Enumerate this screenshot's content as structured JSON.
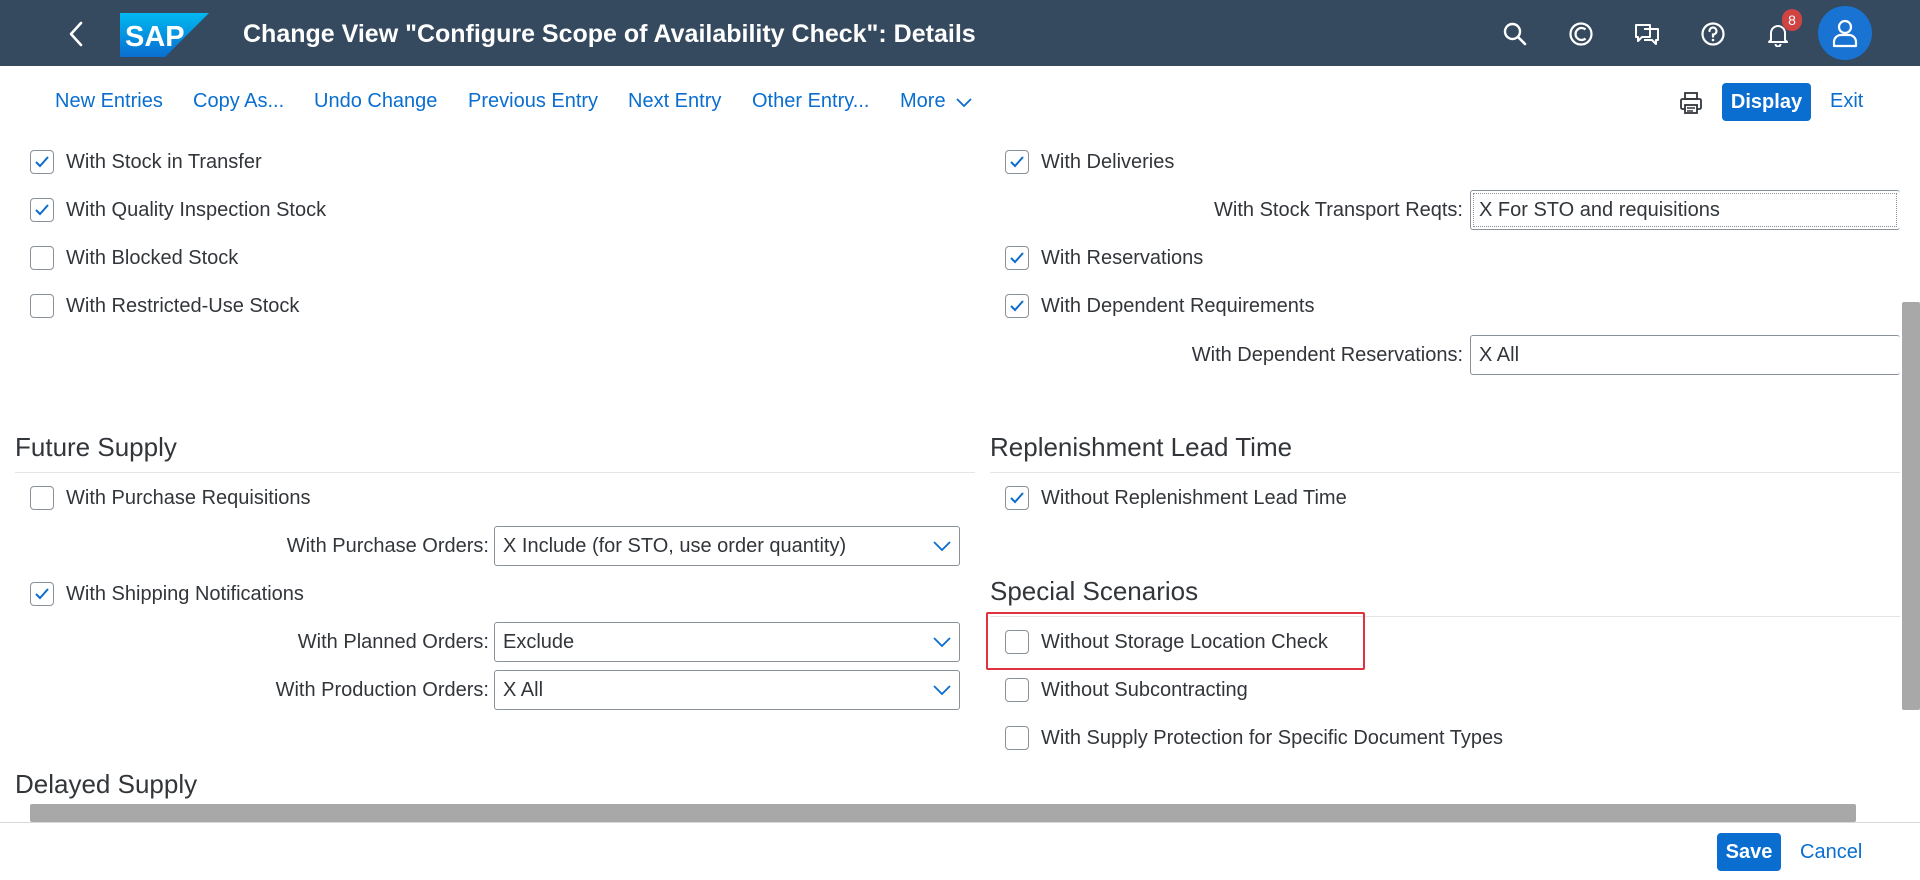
{
  "shell": {
    "logo_text": "SAP",
    "title": "Change View \"Configure Scope of Availability Check\": Details",
    "notification_count": "8",
    "icons": [
      "back-icon",
      "search-icon",
      "copilot-icon",
      "feedback-icon",
      "help-icon",
      "bell-icon",
      "user-icon"
    ],
    "colors": {
      "shell_bg": "#354a5f",
      "accent": "#0a6ed1",
      "badge": "#d04343",
      "highlight": "#e0313f"
    }
  },
  "toolbar": {
    "new_entries": "New Entries",
    "copy_as": "Copy As...",
    "undo_change": "Undo Change",
    "previous_entry": "Previous Entry",
    "next_entry": "Next Entry",
    "other_entry": "Other Entry...",
    "more": "More",
    "display": "Display",
    "exit": "Exit"
  },
  "stock": {
    "with_stock_in_transfer": {
      "label": "With Stock in Transfer",
      "checked": true
    },
    "with_quality_inspection": {
      "label": "With Quality Inspection Stock",
      "checked": true
    },
    "with_blocked_stock": {
      "label": "With Blocked Stock",
      "checked": false
    },
    "with_restricted_use": {
      "label": "With Restricted-Use Stock",
      "checked": false
    }
  },
  "demand": {
    "with_deliveries": {
      "label": "With Deliveries",
      "checked": true
    },
    "stock_transport_reqts_label": "With Stock Transport Reqts:",
    "stock_transport_reqts_value": "X For STO and requisitions",
    "with_reservations": {
      "label": "With Reservations",
      "checked": true
    },
    "with_dependent_requirements": {
      "label": "With Dependent Requirements",
      "checked": true
    },
    "dependent_reservations_label": "With Dependent Reservations:",
    "dependent_reservations_value": "X All"
  },
  "future_supply": {
    "title": "Future Supply",
    "with_purchase_requisitions": {
      "label": "With Purchase Requisitions",
      "checked": false
    },
    "purchase_orders_label": "With Purchase Orders:",
    "purchase_orders_value": "X Include (for STO, use order quantity)",
    "with_shipping_notifications": {
      "label": "With Shipping Notifications",
      "checked": true
    },
    "planned_orders_label": "With Planned Orders:",
    "planned_orders_value": "Exclude",
    "production_orders_label": "With Production Orders:",
    "production_orders_value": "X All"
  },
  "replenishment": {
    "title": "Replenishment Lead Time",
    "without_replenishment": {
      "label": "Without Replenishment Lead Time",
      "checked": true
    }
  },
  "special": {
    "title": "Special Scenarios",
    "without_storage_location_check": {
      "label": "Without Storage Location Check",
      "checked": false
    },
    "without_subcontracting": {
      "label": "Without Subcontracting",
      "checked": false
    },
    "with_supply_protection": {
      "label": "With Supply Protection for Specific Document Types",
      "checked": false
    }
  },
  "delayed_supply": {
    "title": "Delayed Supply"
  },
  "footer": {
    "save": "Save",
    "cancel": "Cancel"
  }
}
